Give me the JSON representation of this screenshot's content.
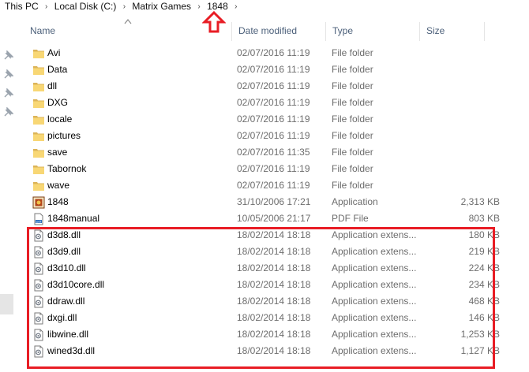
{
  "breadcrumb": {
    "items": [
      "This PC",
      "Local Disk (C:)",
      "Matrix Games",
      "1848"
    ],
    "separator": "›"
  },
  "columns": {
    "name": "Name",
    "date": "Date modified",
    "type": "Type",
    "size": "Size"
  },
  "files": [
    {
      "name": "Avi",
      "date": "02/07/2016 11:19",
      "type": "File folder",
      "size": "",
      "icon": "folder-icon"
    },
    {
      "name": "Data",
      "date": "02/07/2016 11:19",
      "type": "File folder",
      "size": "",
      "icon": "folder-icon"
    },
    {
      "name": "dll",
      "date": "02/07/2016 11:19",
      "type": "File folder",
      "size": "",
      "icon": "folder-icon"
    },
    {
      "name": "DXG",
      "date": "02/07/2016 11:19",
      "type": "File folder",
      "size": "",
      "icon": "folder-icon"
    },
    {
      "name": "locale",
      "date": "02/07/2016 11:19",
      "type": "File folder",
      "size": "",
      "icon": "folder-icon"
    },
    {
      "name": "pictures",
      "date": "02/07/2016 11:19",
      "type": "File folder",
      "size": "",
      "icon": "folder-icon"
    },
    {
      "name": "save",
      "date": "02/07/2016 11:35",
      "type": "File folder",
      "size": "",
      "icon": "folder-icon"
    },
    {
      "name": "Tabornok",
      "date": "02/07/2016 11:19",
      "type": "File folder",
      "size": "",
      "icon": "folder-icon"
    },
    {
      "name": "wave",
      "date": "02/07/2016 11:19",
      "type": "File folder",
      "size": "",
      "icon": "folder-icon"
    },
    {
      "name": "1848",
      "date": "31/10/2006 17:21",
      "type": "Application",
      "size": "2,313 KB",
      "icon": "application-icon"
    },
    {
      "name": "1848manual",
      "date": "10/05/2006 21:17",
      "type": "PDF File",
      "size": "803 KB",
      "icon": "pdf-file-icon"
    },
    {
      "name": "d3d8.dll",
      "date": "18/02/2014 18:18",
      "type": "Application extens...",
      "size": "180 KB",
      "icon": "dll-file-icon"
    },
    {
      "name": "d3d9.dll",
      "date": "18/02/2014 18:18",
      "type": "Application extens...",
      "size": "219 KB",
      "icon": "dll-file-icon"
    },
    {
      "name": "d3d10.dll",
      "date": "18/02/2014 18:18",
      "type": "Application extens...",
      "size": "224 KB",
      "icon": "dll-file-icon"
    },
    {
      "name": "d3d10core.dll",
      "date": "18/02/2014 18:18",
      "type": "Application extens...",
      "size": "234 KB",
      "icon": "dll-file-icon"
    },
    {
      "name": "ddraw.dll",
      "date": "18/02/2014 18:18",
      "type": "Application extens...",
      "size": "468 KB",
      "icon": "dll-file-icon"
    },
    {
      "name": "dxgi.dll",
      "date": "18/02/2014 18:18",
      "type": "Application extens...",
      "size": "146 KB",
      "icon": "dll-file-icon"
    },
    {
      "name": "libwine.dll",
      "date": "18/02/2014 18:18",
      "type": "Application extens...",
      "size": "1,253 KB",
      "icon": "dll-file-icon"
    },
    {
      "name": "wined3d.dll",
      "date": "18/02/2014 18:18",
      "type": "Application extens...",
      "size": "1,127 KB",
      "icon": "dll-file-icon"
    }
  ],
  "colors": {
    "annotation_red": "#e81d25",
    "folder_yellow": "#f8d775",
    "header_text": "#4c607a",
    "secondary_text": "#6d6d6d"
  }
}
